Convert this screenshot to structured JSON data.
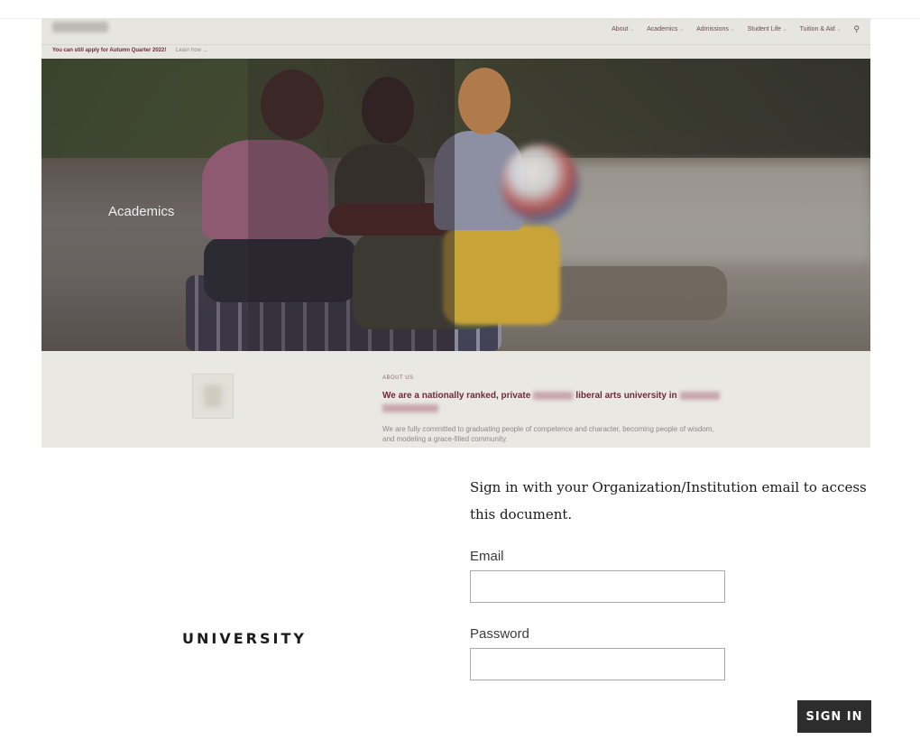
{
  "preview": {
    "nav": [
      "About",
      "Academics",
      "Admissions",
      "Student Life",
      "Tuition & Aid"
    ],
    "announcement": "You can still apply for Autumn Quarter 2022!",
    "announcement_link": "Learn how →",
    "hero_label": "Academics",
    "about_kicker": "ABOUT US",
    "about_title_a": "We are a nationally ranked, private",
    "about_title_b": "liberal arts university in",
    "about_body": "We are fully committed to graduating people of competence and character, becoming people of wisdom, and modeling a grace-filled community."
  },
  "brand": {
    "logo_text": "UNIVERSITY"
  },
  "signin": {
    "prompt": "Sign in with your Organization/Institution email to access this document.",
    "email_label": "Email",
    "email_value": "",
    "password_label": "Password",
    "password_value": "",
    "button_label": "SIGN IN"
  },
  "icons": {
    "search": "search-icon"
  }
}
